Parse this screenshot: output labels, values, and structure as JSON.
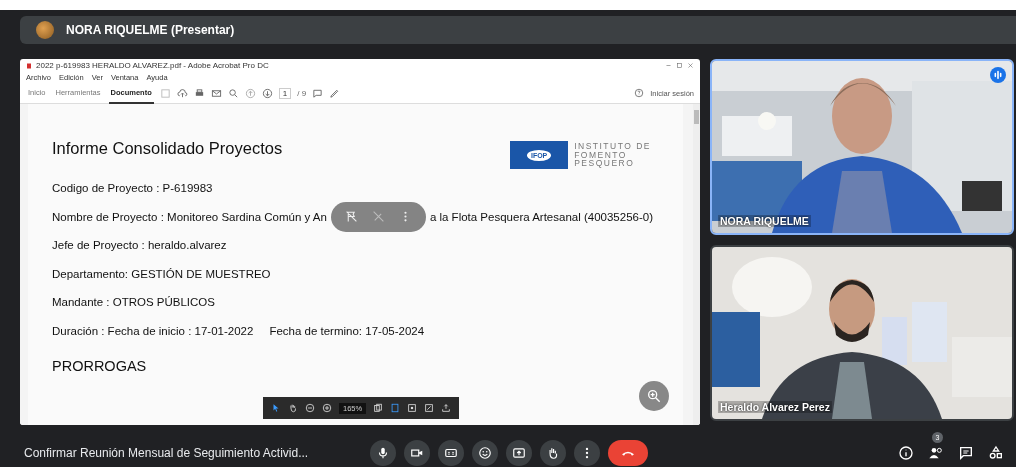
{
  "header": {
    "presenter": "NORA RIQUELME (Presentar)"
  },
  "acrobat": {
    "title": "2022 p-619983 HERALDO ALVAREZ.pdf - Adobe Acrobat Pro DC",
    "menu": [
      "Archivo",
      "Edición",
      "Ver",
      "Ventana",
      "Ayuda"
    ],
    "tabs": [
      {
        "label": "Inicio",
        "selected": false
      },
      {
        "label": "Herramientas",
        "selected": false
      },
      {
        "label": "Documento",
        "selected": true
      }
    ],
    "page": "1",
    "page_total": "/ 9",
    "sign_in": "Iniciar sesión",
    "zoom_level": "165%"
  },
  "document": {
    "title": "Informe Consolidado Proyectos",
    "logo": {
      "mark": "IFOP",
      "lines": [
        "INSTITUTO DE",
        "FOMENTO",
        "PESQUERO"
      ]
    },
    "fields": [
      {
        "kind": "plain",
        "parts": [
          "Codigo de Proyecto : P-619983"
        ]
      },
      {
        "kind": "covered",
        "parts": [
          "Nombre de Proyecto : Monitoreo Sardina Común y An",
          "a la Flota Pesquera Artesanal (40035256-0)"
        ]
      },
      {
        "kind": "plain",
        "parts": [
          "Jefe de Proyecto :  heraldo.alvarez"
        ]
      },
      {
        "kind": "plain",
        "parts": [
          "Departamento:  GESTIÓN DE MUESTREO"
        ]
      },
      {
        "kind": "plain",
        "parts": [
          "Mandante : OTROS PÚBLICOS"
        ]
      },
      {
        "kind": "plain",
        "parts": [
          "Duración :  Fecha de inicio : 17-01-2022",
          "Fecha de termino: 17-05-2024"
        ]
      }
    ],
    "section": "PRORROGAS"
  },
  "participants": [
    {
      "name": "NORA RIQUELME",
      "speaking": true
    },
    {
      "name": "Heraldo Alvarez Perez",
      "speaking": false
    }
  ],
  "meeting": {
    "title": "Confirmar Reunión Mensual de Seguimiento Activid...",
    "people_count": "3"
  }
}
